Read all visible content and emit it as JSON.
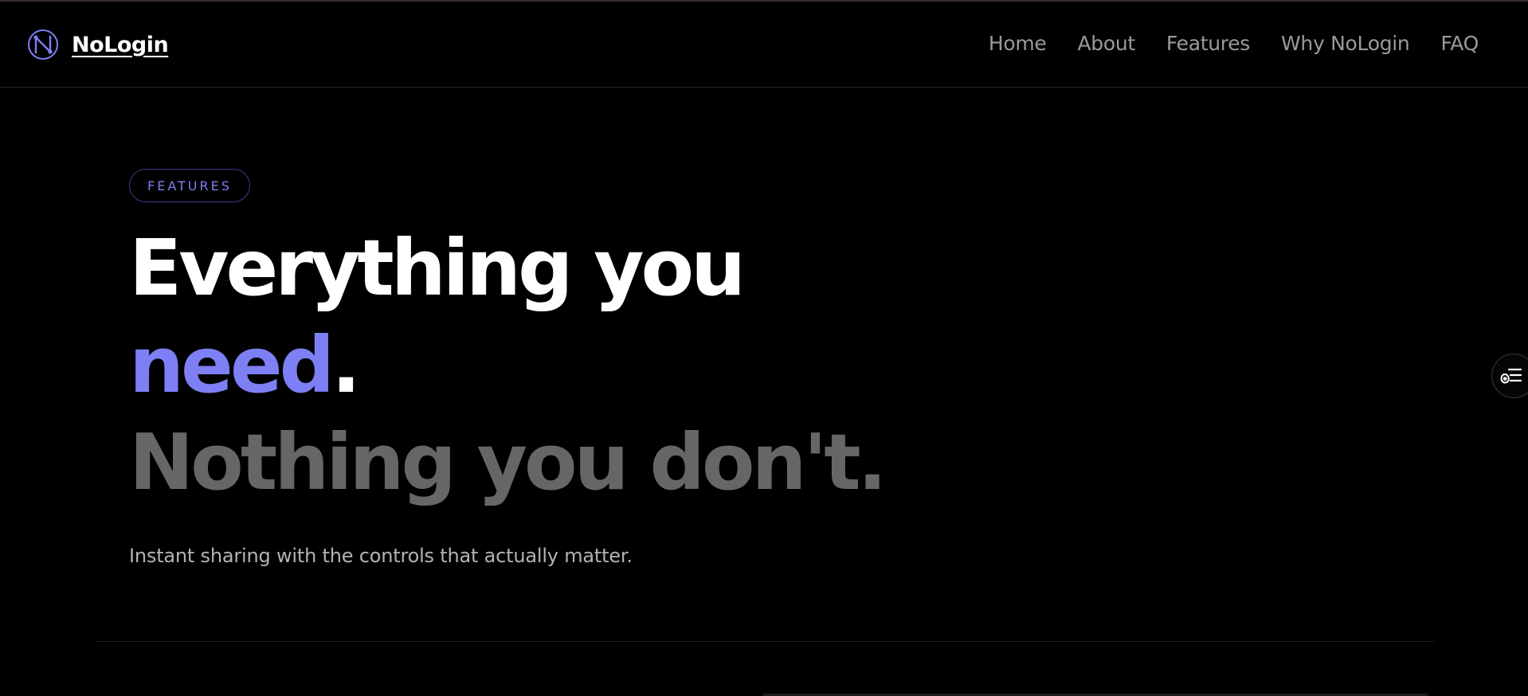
{
  "header": {
    "brand_name": "NoLogin",
    "logo_icon": "nologin-logo-icon",
    "nav": [
      {
        "label": "Home"
      },
      {
        "label": "About"
      },
      {
        "label": "Features"
      },
      {
        "label": "Why NoLogin"
      },
      {
        "label": "FAQ"
      }
    ]
  },
  "hero": {
    "badge": "FEATURES",
    "headline_line1": "Everything you",
    "headline_accent": "need",
    "headline_period": ".",
    "headline_line3": "Nothing you don't.",
    "subtitle": "Instant sharing with the controls that actually matter."
  },
  "side_toggle": {
    "icon": "accessibility-menu-icon"
  },
  "colors": {
    "background": "#000000",
    "accent": "#7e7ff4",
    "muted_text": "#9a9a9a",
    "headline_grey": "#666666"
  }
}
